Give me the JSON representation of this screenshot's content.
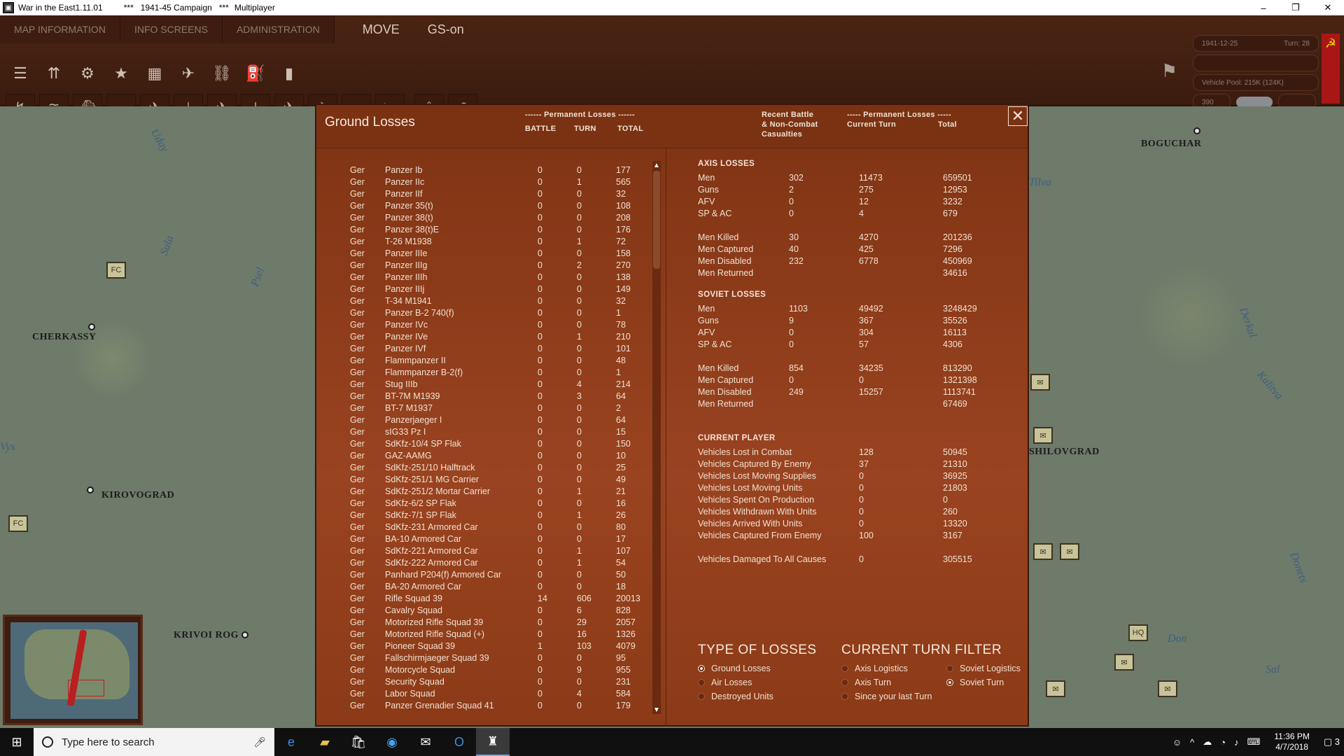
{
  "window": {
    "title": "War in the East1.11.01",
    "campaign": "***   1941-45 Campaign   ***",
    "mode": "Multiplayer",
    "controls": [
      "–",
      "❐",
      "✕"
    ]
  },
  "menu": {
    "tabs": [
      "MAP INFORMATION",
      "INFO SCREENS",
      "ADMINISTRATION"
    ],
    "mode_move": "MOVE",
    "mode_gs": "GS-on"
  },
  "status": {
    "date": "1941-12-25",
    "turn": "Turn: 28",
    "vehicle_pool": "Vehicle Pool: 215K (124K)",
    "admin_points": "390"
  },
  "toolbar": {
    "row1_icons": [
      "hamburger-icon",
      "units-icon",
      "gear-icon",
      "star-icon",
      "hq-icon",
      "air-icon",
      "rail-icon",
      "fuel-icon",
      "supply-icon"
    ],
    "row1_glyphs": [
      "☰",
      "⇈",
      "⚙",
      "★",
      "▦",
      "✈",
      "⛓",
      "⛽",
      "▮"
    ],
    "row2_icons": [
      "f1-icon",
      "f2-icon",
      "f3-icon",
      "f4-icon",
      "f5-icon",
      "f6-icon",
      "f7-icon",
      "f8-icon",
      "f9-icon",
      "f10-icon",
      "f11-icon",
      "f12-icon",
      "upload-icon",
      "undo-icon"
    ],
    "row2_glyphs": [
      "↯",
      "≋",
      "⛴",
      "▬",
      "✈",
      "⊥",
      "✈",
      "⟂",
      "✈",
      "✈",
      "♆",
      "▶",
      "⇪",
      "↶"
    ]
  },
  "map": {
    "cities": [
      "BOGUCHAR",
      "CHERKASSY",
      "KIROVOGRAD",
      "KRIVOI ROG",
      "SHILOVGRAD"
    ],
    "rivers": [
      "Sula",
      "Uday",
      "Psel",
      "Vys",
      "Tilva",
      "Derkul",
      "Kalitva",
      "Donets",
      "Don",
      "Sal"
    ]
  },
  "dialog": {
    "title": "Ground Losses",
    "close_label": "✕",
    "headers": {
      "perm_losses": "------ Permanent Losses ------",
      "battle": "BATTLE",
      "turn": "TURN",
      "total": "TOTAL",
      "recent_line1": "Recent Battle",
      "recent_line2": "& Non-Combat",
      "recent_line3": "Casualties",
      "perm_losses2": "----- Permanent Losses -----",
      "current_turn": "Current Turn",
      "total2": "Total"
    },
    "ground_losses": [
      {
        "nat": "Ger",
        "name": "Panzer Ib",
        "battle": "0",
        "turn": "0",
        "total": "177"
      },
      {
        "nat": "Ger",
        "name": "Panzer IIc",
        "battle": "0",
        "turn": "1",
        "total": "565"
      },
      {
        "nat": "Ger",
        "name": "Panzer IIf",
        "battle": "0",
        "turn": "0",
        "total": "32"
      },
      {
        "nat": "Ger",
        "name": "Panzer 35(t)",
        "battle": "0",
        "turn": "0",
        "total": "108"
      },
      {
        "nat": "Ger",
        "name": "Panzer 38(t)",
        "battle": "0",
        "turn": "0",
        "total": "208"
      },
      {
        "nat": "Ger",
        "name": "Panzer 38(t)E",
        "battle": "0",
        "turn": "0",
        "total": "176"
      },
      {
        "nat": "Ger",
        "name": "T-26 M1938",
        "battle": "0",
        "turn": "1",
        "total": "72"
      },
      {
        "nat": "Ger",
        "name": "Panzer IIIe",
        "battle": "0",
        "turn": "0",
        "total": "158"
      },
      {
        "nat": "Ger",
        "name": "Panzer IIIg",
        "battle": "0",
        "turn": "2",
        "total": "270"
      },
      {
        "nat": "Ger",
        "name": "Panzer IIIh",
        "battle": "0",
        "turn": "0",
        "total": "138"
      },
      {
        "nat": "Ger",
        "name": "Panzer IIIj",
        "battle": "0",
        "turn": "0",
        "total": "149"
      },
      {
        "nat": "Ger",
        "name": "T-34 M1941",
        "battle": "0",
        "turn": "0",
        "total": "32"
      },
      {
        "nat": "Ger",
        "name": "Panzer B-2 740(f)",
        "battle": "0",
        "turn": "0",
        "total": "1"
      },
      {
        "nat": "Ger",
        "name": "Panzer IVc",
        "battle": "0",
        "turn": "0",
        "total": "78"
      },
      {
        "nat": "Ger",
        "name": "Panzer IVe",
        "battle": "0",
        "turn": "1",
        "total": "210"
      },
      {
        "nat": "Ger",
        "name": "Panzer IVf",
        "battle": "0",
        "turn": "0",
        "total": "101"
      },
      {
        "nat": "Ger",
        "name": "Flammpanzer II",
        "battle": "0",
        "turn": "0",
        "total": "48"
      },
      {
        "nat": "Ger",
        "name": "Flammpanzer B-2(f)",
        "battle": "0",
        "turn": "0",
        "total": "1"
      },
      {
        "nat": "Ger",
        "name": "Stug IIIb",
        "battle": "0",
        "turn": "4",
        "total": "214"
      },
      {
        "nat": "Ger",
        "name": "BT-7M M1939",
        "battle": "0",
        "turn": "3",
        "total": "64"
      },
      {
        "nat": "Ger",
        "name": "BT-7 M1937",
        "battle": "0",
        "turn": "0",
        "total": "2"
      },
      {
        "nat": "Ger",
        "name": "Panzerjaeger I",
        "battle": "0",
        "turn": "0",
        "total": "64"
      },
      {
        "nat": "Ger",
        "name": "sIG33 Pz I",
        "battle": "0",
        "turn": "0",
        "total": "15"
      },
      {
        "nat": "Ger",
        "name": "SdKfz-10/4 SP Flak",
        "battle": "0",
        "turn": "0",
        "total": "150"
      },
      {
        "nat": "Ger",
        "name": "GAZ-AAMG",
        "battle": "0",
        "turn": "0",
        "total": "10"
      },
      {
        "nat": "Ger",
        "name": "SdKfz-251/10 Halftrack",
        "battle": "0",
        "turn": "0",
        "total": "25"
      },
      {
        "nat": "Ger",
        "name": "SdKfz-251/1 MG Carrier",
        "battle": "0",
        "turn": "0",
        "total": "49"
      },
      {
        "nat": "Ger",
        "name": "SdKfz-251/2 Mortar Carrier",
        "battle": "0",
        "turn": "1",
        "total": "21"
      },
      {
        "nat": "Ger",
        "name": "SdKfz-6/2 SP Flak",
        "battle": "0",
        "turn": "0",
        "total": "16"
      },
      {
        "nat": "Ger",
        "name": "SdKfz-7/1 SP Flak",
        "battle": "0",
        "turn": "1",
        "total": "26"
      },
      {
        "nat": "Ger",
        "name": "SdKfz-231 Armored Car",
        "battle": "0",
        "turn": "0",
        "total": "80"
      },
      {
        "nat": "Ger",
        "name": "BA-10 Armored Car",
        "battle": "0",
        "turn": "0",
        "total": "17"
      },
      {
        "nat": "Ger",
        "name": "SdKfz-221 Armored Car",
        "battle": "0",
        "turn": "1",
        "total": "107"
      },
      {
        "nat": "Ger",
        "name": "SdKfz-222 Armored Car",
        "battle": "0",
        "turn": "1",
        "total": "54"
      },
      {
        "nat": "Ger",
        "name": "Panhard P204(f) Armored Car",
        "battle": "0",
        "turn": "0",
        "total": "50"
      },
      {
        "nat": "Ger",
        "name": "BA-20 Armored Car",
        "battle": "0",
        "turn": "0",
        "total": "18"
      },
      {
        "nat": "Ger",
        "name": "Rifle Squad 39",
        "battle": "14",
        "turn": "606",
        "total": "20013"
      },
      {
        "nat": "Ger",
        "name": "Cavalry Squad",
        "battle": "0",
        "turn": "6",
        "total": "828"
      },
      {
        "nat": "Ger",
        "name": "Motorized Rifle Squad 39",
        "battle": "0",
        "turn": "29",
        "total": "2057"
      },
      {
        "nat": "Ger",
        "name": "Motorized Rifle Squad (+)",
        "battle": "0",
        "turn": "16",
        "total": "1326"
      },
      {
        "nat": "Ger",
        "name": "Pioneer Squad 39",
        "battle": "1",
        "turn": "103",
        "total": "4079"
      },
      {
        "nat": "Ger",
        "name": "Fallschirmjaeger Squad 39",
        "battle": "0",
        "turn": "0",
        "total": "95"
      },
      {
        "nat": "Ger",
        "name": "Motorcycle Squad",
        "battle": "0",
        "turn": "9",
        "total": "955"
      },
      {
        "nat": "Ger",
        "name": "Security Squad",
        "battle": "0",
        "turn": "0",
        "total": "231"
      },
      {
        "nat": "Ger",
        "name": "Labor Squad",
        "battle": "0",
        "turn": "4",
        "total": "584"
      },
      {
        "nat": "Ger",
        "name": "Panzer Grenadier Squad 41",
        "battle": "0",
        "turn": "0",
        "total": "179"
      }
    ],
    "axis": {
      "title": "AXIS LOSSES",
      "rows": [
        {
          "label": "Men",
          "recent": "302",
          "turn": "11473",
          "total": "659501"
        },
        {
          "label": "Guns",
          "recent": "2",
          "turn": "275",
          "total": "12953"
        },
        {
          "label": "AFV",
          "recent": "0",
          "turn": "12",
          "total": "3232"
        },
        {
          "label": "SP & AC",
          "recent": "0",
          "turn": "4",
          "total": "679"
        },
        {
          "label": "Men Killed",
          "recent": "30",
          "turn": "4270",
          "total": "201236"
        },
        {
          "label": "Men Captured",
          "recent": "40",
          "turn": "425",
          "total": "7296"
        },
        {
          "label": "Men Disabled",
          "recent": "232",
          "turn": "6778",
          "total": "450969"
        },
        {
          "label": "Men Returned",
          "recent": "",
          "turn": "",
          "total": "34616"
        }
      ]
    },
    "soviet": {
      "title": "SOVIET LOSSES",
      "rows": [
        {
          "label": "Men",
          "recent": "1103",
          "turn": "49492",
          "total": "3248429"
        },
        {
          "label": "Guns",
          "recent": "9",
          "turn": "367",
          "total": "35526"
        },
        {
          "label": "AFV",
          "recent": "0",
          "turn": "304",
          "total": "16113"
        },
        {
          "label": "SP & AC",
          "recent": "0",
          "turn": "57",
          "total": "4306"
        },
        {
          "label": "Men Killed",
          "recent": "854",
          "turn": "34235",
          "total": "813290"
        },
        {
          "label": "Men Captured",
          "recent": "0",
          "turn": "0",
          "total": "1321398"
        },
        {
          "label": "Men Disabled",
          "recent": "249",
          "turn": "15257",
          "total": "1113741"
        },
        {
          "label": "Men Returned",
          "recent": "",
          "turn": "",
          "total": "67469"
        }
      ]
    },
    "player": {
      "title": "CURRENT PLAYER",
      "rows": [
        {
          "label": "Vehicles Lost in Combat",
          "turn": "128",
          "total": "50945"
        },
        {
          "label": "Vehicles Captured By Enemy",
          "turn": "37",
          "total": "21310"
        },
        {
          "label": "Vehicles Lost Moving Supplies",
          "turn": "0",
          "total": "36925"
        },
        {
          "label": "Vehicles Lost Moving Units",
          "turn": "0",
          "total": "21803"
        },
        {
          "label": "Vehicles Spent On Production",
          "turn": "0",
          "total": "0"
        },
        {
          "label": "Vehicles Withdrawn With Units",
          "turn": "0",
          "total": "260"
        },
        {
          "label": "Vehicles Arrived With Units",
          "turn": "0",
          "total": "13320"
        },
        {
          "label": "Vehicles Captured From Enemy",
          "turn": "100",
          "total": "3167"
        },
        {
          "label": "Vehicles Damaged To All Causes",
          "turn": "0",
          "total": "305515"
        }
      ]
    },
    "type_of_losses": {
      "title": "TYPE OF LOSSES",
      "options": [
        "Ground Losses",
        "Air Losses",
        "Destroyed Units"
      ],
      "selected": "Ground Losses"
    },
    "turn_filter": {
      "title": "CURRENT TURN FILTER",
      "options": [
        "Axis Logistics",
        "Soviet Logistics",
        "Axis Turn",
        "Soviet Turn",
        "Since your last Turn"
      ],
      "selected": "Soviet Turn"
    }
  },
  "taskbar": {
    "search_placeholder": "Type here to search",
    "time": "11:36 PM",
    "date": "4/7/2018",
    "notifications": "3"
  }
}
